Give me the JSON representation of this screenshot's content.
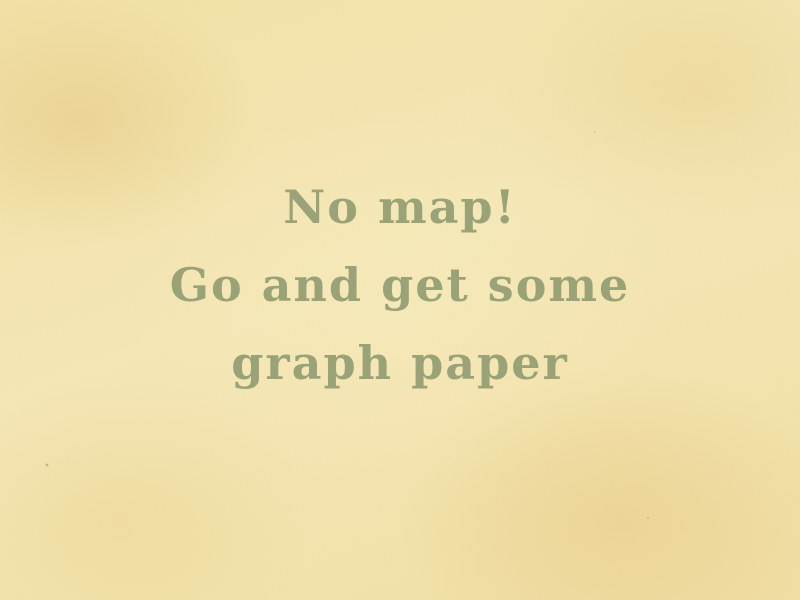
{
  "screen": {
    "background": "parchment",
    "colors": {
      "parchment": "#f4e6b0",
      "text": "#9aa377"
    }
  },
  "message": {
    "lines": [
      "No map!",
      "Go and get some",
      "graph paper"
    ]
  }
}
